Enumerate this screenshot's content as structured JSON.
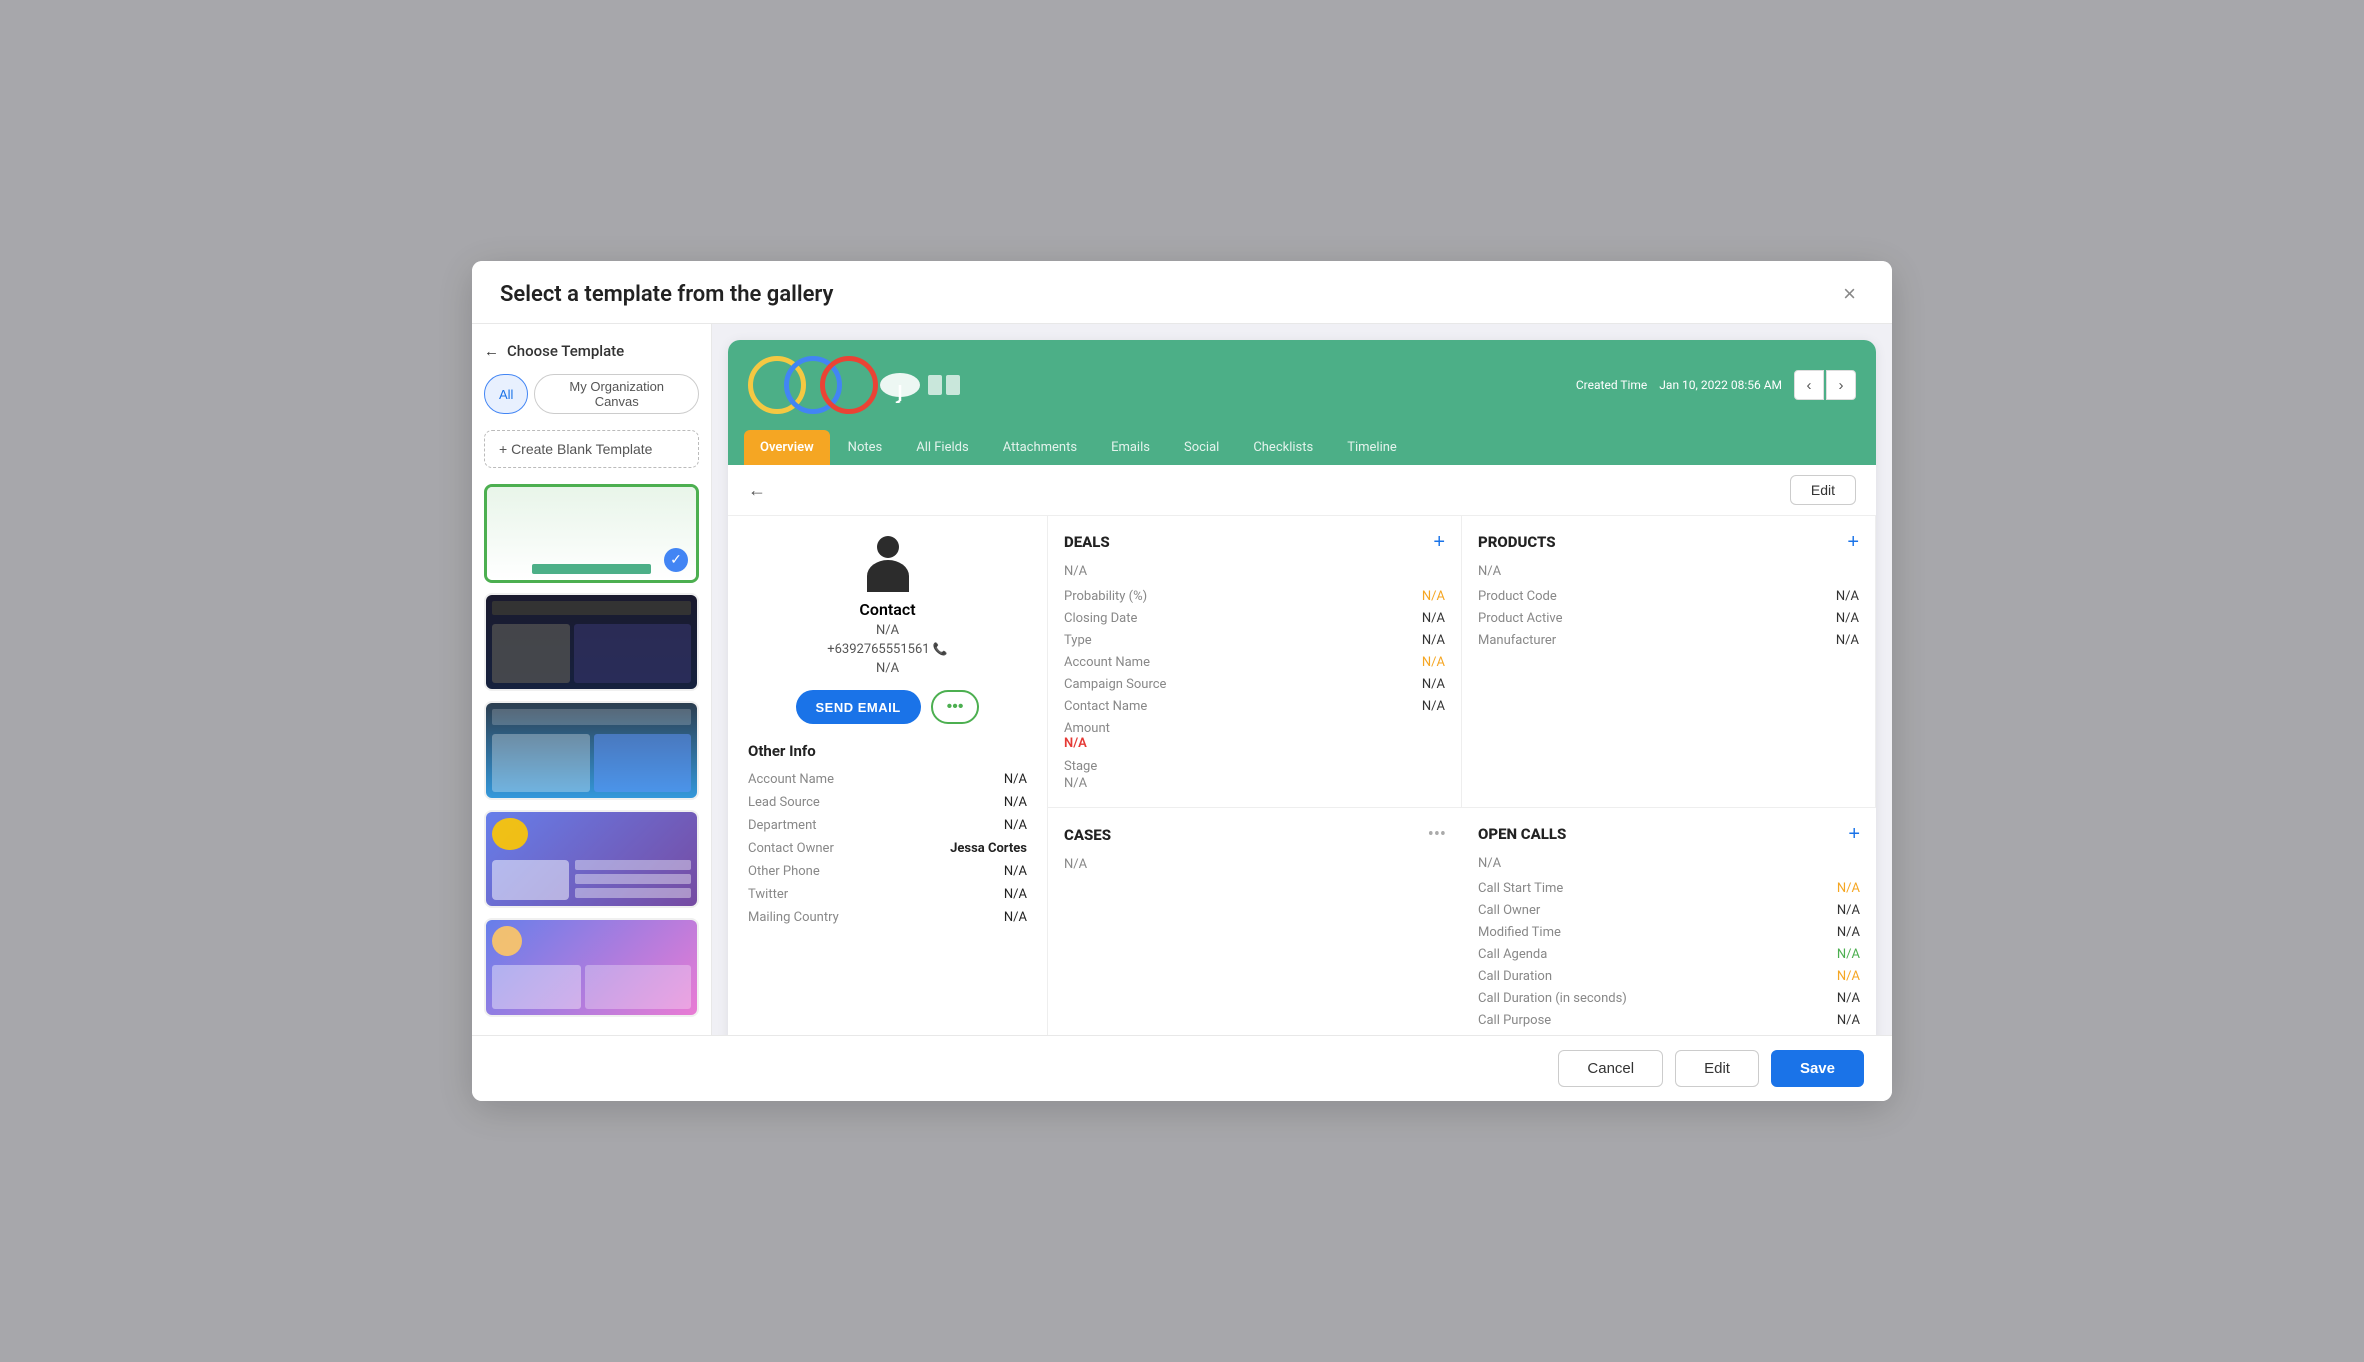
{
  "modal": {
    "title": "Select a template from the gallery",
    "close_label": "×"
  },
  "sidebar": {
    "back_label": "Choose Template",
    "filter_all": "All",
    "filter_my_org": "My Organization Canvas",
    "create_blank_label": "+ Create Blank Template",
    "templates": [
      {
        "id": "tpl-1",
        "selected": true
      },
      {
        "id": "tpl-2",
        "selected": false
      },
      {
        "id": "tpl-3",
        "selected": false
      },
      {
        "id": "tpl-4",
        "selected": false
      },
      {
        "id": "tpl-5",
        "selected": false
      }
    ]
  },
  "preview": {
    "created_label": "Created Time",
    "created_value": "Jan 10, 2022 08:56 AM",
    "tabs": [
      "Overview",
      "Notes",
      "All Fields",
      "Attachments",
      "Emails",
      "Social",
      "Checklists",
      "Timeline"
    ],
    "active_tab": "Overview",
    "back_icon": "←",
    "edit_label": "Edit",
    "contact": {
      "name": "Contact",
      "na": "N/A",
      "phone": "+6392765551561",
      "na2": "N/A",
      "send_email_label": "SEND EMAIL",
      "more_label": "•••",
      "other_info_title": "Other Info",
      "fields": [
        {
          "label": "Account Name",
          "value": "N/A"
        },
        {
          "label": "Lead Source",
          "value": "N/A"
        },
        {
          "label": "Department",
          "value": "N/A"
        },
        {
          "label": "Contact Owner",
          "value": "Jessa Cortes",
          "bold": true
        },
        {
          "label": "Other Phone",
          "value": "N/A"
        },
        {
          "label": "Twitter",
          "value": "N/A"
        },
        {
          "label": "Mailing Country",
          "value": "N/A"
        }
      ]
    },
    "deals": {
      "title": "DEALS",
      "na": "N/A",
      "fields": [
        {
          "label": "Probability (%)",
          "value": "N/A",
          "orange": true
        },
        {
          "label": "Closing Date",
          "value": "N/A"
        },
        {
          "label": "Type",
          "value": "N/A"
        },
        {
          "label": "Account Name",
          "value": "N/A",
          "orange": true
        },
        {
          "label": "Campaign Source",
          "value": "N/A"
        },
        {
          "label": "Contact Name",
          "value": "N/A"
        }
      ],
      "amount_label": "Amount",
      "amount_value": "N/A",
      "stage_label": "Stage",
      "stage_value": "N/A"
    },
    "products": {
      "title": "PRODUCTS",
      "na": "N/A",
      "fields": [
        {
          "label": "Product Code",
          "value": "N/A"
        },
        {
          "label": "Product Active",
          "value": "N/A"
        },
        {
          "label": "Manufacturer",
          "value": "N/A"
        }
      ]
    },
    "cases": {
      "title": "CASES",
      "na": "N/A"
    },
    "open_calls": {
      "title": "OPEN CALLS",
      "na": "N/A",
      "fields": [
        {
          "label": "Call Start Time",
          "value": "N/A",
          "orange": true
        },
        {
          "label": "Call Owner",
          "value": "N/A"
        },
        {
          "label": "Modified Time",
          "value": "N/A"
        },
        {
          "label": "Call Agenda",
          "value": "N/A",
          "green": true
        },
        {
          "label": "Call Duration",
          "value": "N/A",
          "orange": true
        },
        {
          "label": "Call Duration (in seconds)",
          "value": "N/A"
        },
        {
          "label": "Call Purpose",
          "value": "N/A"
        }
      ]
    }
  },
  "footer": {
    "cancel_label": "Cancel",
    "edit_label": "Edit",
    "save_label": "Save"
  }
}
